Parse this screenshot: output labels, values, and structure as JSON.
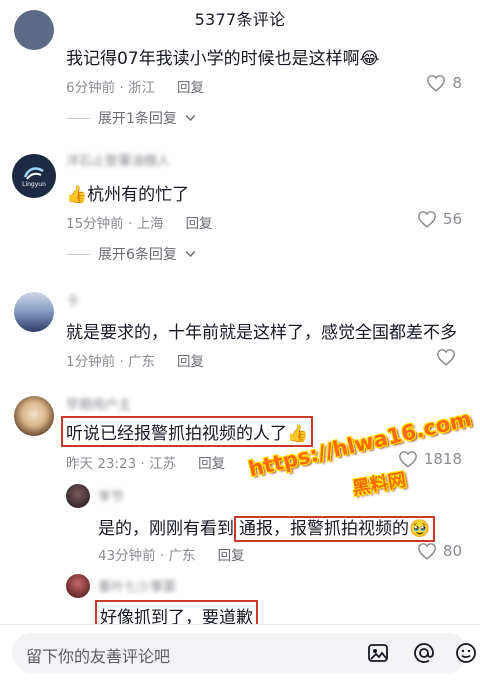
{
  "header": {
    "title": "5377条评论"
  },
  "comments": [
    {
      "text": "我记得07年我读小学的时候也是这样啊",
      "emoji": "😂",
      "time": "6分钟前",
      "location": "浙江",
      "reply_label": "回复",
      "likes": "8",
      "expand_label": "展开1条回复"
    },
    {
      "author": "洋石止管署油棚人",
      "avatar_text": "Lingyun",
      "prefix_emoji": "👍",
      "text": "杭州有的忙了",
      "time": "15分钟前",
      "location": "上海",
      "reply_label": "回复",
      "likes": "56",
      "expand_label": "展开6条回复"
    },
    {
      "author": "卡",
      "text": "就是要求的，十年前就是这样了，感觉全国都差不多",
      "time": "1分钟前",
      "location": "广东",
      "reply_label": "回复",
      "likes": ""
    },
    {
      "author": "早期用户主",
      "text": "听说已经报警抓拍视频的人了",
      "emoji": "👍",
      "time": "昨天 23:23",
      "location": "江苏",
      "reply_label": "回复",
      "likes": "1818"
    }
  ],
  "replies": [
    {
      "author": "李节",
      "text_a": "是的，刚刚有看到",
      "text_b": "通报，报警抓拍视频的",
      "emoji": "🥹",
      "time": "43分钟前",
      "location": "广东",
      "reply_label": "回复",
      "likes": "80"
    },
    {
      "author": "重叶七少事罢",
      "text": "好像抓到了，要道歉"
    }
  ],
  "watermark": {
    "url": "https://hlwa16.com",
    "name": "黑料网"
  },
  "bottom_bar": {
    "placeholder": "留下你的友善评论吧",
    "icons": [
      "image-icon",
      "at-icon",
      "emoji-icon"
    ]
  },
  "colors": {
    "highlight_border": "#c83b2c",
    "watermark": "#ff6a00",
    "meta": "#8a8b91"
  }
}
